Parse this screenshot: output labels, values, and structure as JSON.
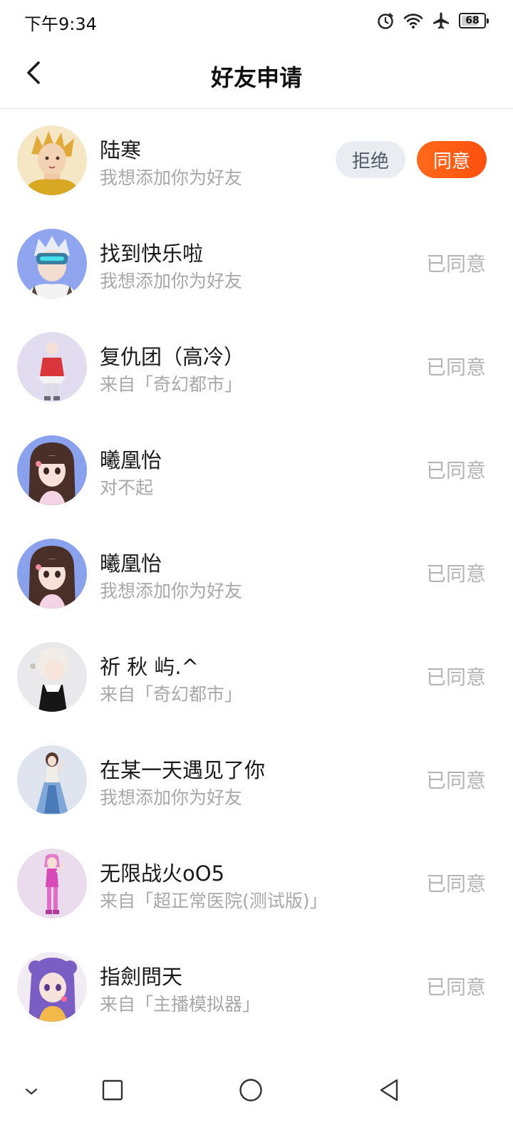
{
  "status_bar": {
    "time": "下午9:34",
    "battery": "68",
    "icons": [
      "alarm-icon",
      "wifi-icon",
      "airplane-icon",
      "battery-icon"
    ]
  },
  "header": {
    "title": "好友申请",
    "back_icon": "chevron-left-icon"
  },
  "colors": {
    "accent": "#ff5a12",
    "reject_bg": "#e9edf2",
    "muted_text": "#a8a8a8"
  },
  "requests": [
    {
      "name": "陆寒",
      "message": "我想添加你为好友",
      "reject_label": "拒绝",
      "accept_label": "同意"
    },
    {
      "name": "找到快乐啦",
      "message": "我想添加你为好友",
      "status": "已同意"
    },
    {
      "name": "复仇团（高冷）",
      "message": "来自「奇幻都市」",
      "status": "已同意"
    },
    {
      "name": "曦凰怡",
      "message": "对不起",
      "status": "已同意"
    },
    {
      "name": "曦凰怡",
      "message": "我想添加你为好友",
      "status": "已同意"
    },
    {
      "name": "祈 秋 屿.^",
      "message": "来自「奇幻都市」",
      "status": "已同意"
    },
    {
      "name": "在某一天遇见了你",
      "message": "我想添加你为好友",
      "status": "已同意"
    },
    {
      "name": "无限战火oO5",
      "message": "来自「超正常医院(测试版)」",
      "status": "已同意"
    },
    {
      "name": "指劍問天",
      "message": "来自「主播模拟器」",
      "status": "已同意"
    }
  ],
  "nav_bar": {
    "icons": [
      "chevron-down-icon",
      "square-icon",
      "circle-icon",
      "triangle-back-icon"
    ]
  }
}
